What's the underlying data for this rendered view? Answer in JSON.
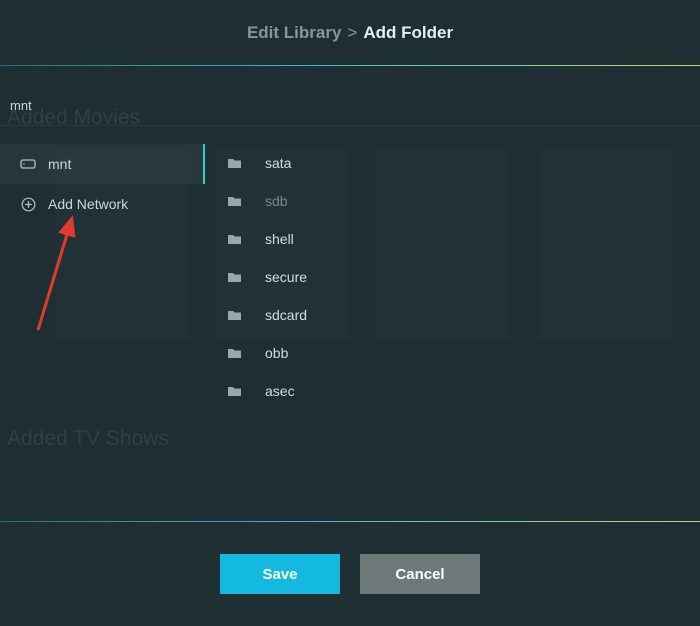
{
  "breadcrumb": {
    "parent": "Edit Library",
    "separator": ">",
    "current": "Add Folder"
  },
  "path": "mnt",
  "background_sections": {
    "movies": "Added Movies",
    "tv": "Added TV Shows"
  },
  "sidebar": {
    "items": [
      {
        "label": "mnt",
        "icon": "drive-icon",
        "selected": true
      },
      {
        "label": "Add Network",
        "icon": "add-circle-icon",
        "selected": false
      }
    ]
  },
  "folders": [
    {
      "name": "sata",
      "dim": false
    },
    {
      "name": "sdb",
      "dim": true
    },
    {
      "name": "shell",
      "dim": false
    },
    {
      "name": "secure",
      "dim": false
    },
    {
      "name": "sdcard",
      "dim": false
    },
    {
      "name": "obb",
      "dim": false
    },
    {
      "name": "asec",
      "dim": false
    }
  ],
  "buttons": {
    "save": "Save",
    "cancel": "Cancel"
  },
  "colors": {
    "accent": "#14b9e0",
    "selection_indicator": "#29d0c9",
    "bg": "#1f2e33",
    "button_secondary": "#6e7879"
  }
}
